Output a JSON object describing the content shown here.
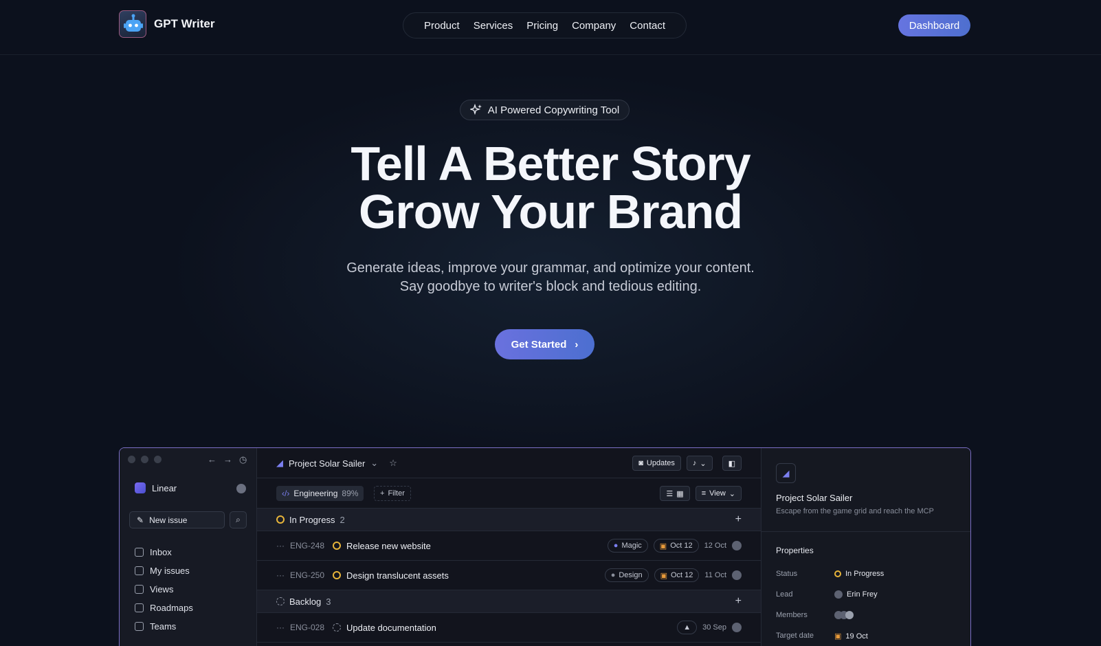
{
  "header": {
    "brand": "GPT Writer",
    "logo_icon": "robot-icon",
    "nav": [
      "Product",
      "Services",
      "Pricing",
      "Company",
      "Contact"
    ],
    "dashboard_label": "Dashboard"
  },
  "hero": {
    "badge": "AI Powered Copywriting Tool",
    "badge_icon": "sparkles-icon",
    "title_line1": "Tell A Better Story",
    "title_line2": "Grow Your Brand",
    "subtitle_line1": "Generate ideas, improve your grammar, and optimize your content.",
    "subtitle_line2": "Say goodbye to writer's block and tedious editing.",
    "cta_label": "Get Started"
  },
  "colors": {
    "background": "#0c111d",
    "accent": "#6674e0",
    "in_progress": "#e8b53a"
  },
  "app": {
    "workspace": "Linear",
    "new_issue": "New issue",
    "sidebar": [
      "Inbox",
      "My issues",
      "Views",
      "Roadmaps",
      "Teams"
    ],
    "project": "Project Solar Sailer",
    "updates": "Updates",
    "team": "Engineering",
    "team_pct": "89%",
    "filter": "Filter",
    "view": "View",
    "groups": [
      {
        "name": "In Progress",
        "count": "2",
        "rows": [
          {
            "id": "ENG-248",
            "title": "Release new website",
            "tag": "Magic",
            "due": "Oct 12",
            "date": "12 Oct"
          },
          {
            "id": "ENG-250",
            "title": "Design translucent assets",
            "tag": "Design",
            "due": "Oct 12",
            "date": "11 Oct"
          }
        ]
      },
      {
        "name": "Backlog",
        "count": "3",
        "rows": [
          {
            "id": "ENG-028",
            "title": "Update documentation",
            "date": "30 Sep"
          }
        ]
      }
    ],
    "panel": {
      "title": "Project Solar Sailer",
      "desc": "Escape from the game grid and reach the MCP",
      "properties_label": "Properties",
      "status_label": "Status",
      "status_value": "In Progress",
      "lead_label": "Lead",
      "lead_value": "Erin Frey",
      "members_label": "Members",
      "target_label": "Target date",
      "target_value": "19 Oct"
    }
  }
}
